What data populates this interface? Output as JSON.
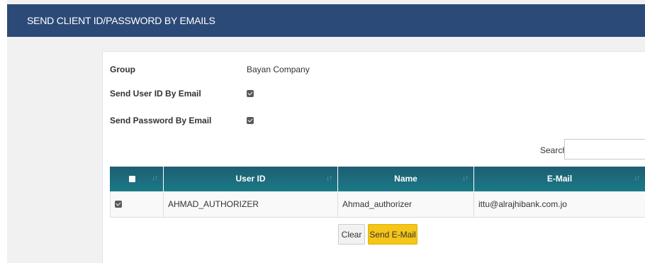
{
  "header": {
    "title": "SEND CLIENT ID/PASSWORD BY EMAILS"
  },
  "form": {
    "group_label": "Group",
    "group_value": "Bayan Company",
    "send_userid_label": "Send User ID By Email",
    "send_userid_checked": true,
    "send_password_label": "Send Password By Email",
    "send_password_checked": true
  },
  "search": {
    "label": "Search:",
    "value": "",
    "placeholder": ""
  },
  "table": {
    "columns": [
      "",
      "User ID",
      "Name",
      "E-Mail"
    ],
    "rows": [
      {
        "selected": true,
        "user_id": "AHMAD_AUTHORIZER",
        "name": "Ahmad_authorizer",
        "email": "ittu@alrajhibank.com.jo"
      }
    ]
  },
  "buttons": {
    "clear": "Clear",
    "send": "Send E-Mail"
  },
  "colors": {
    "header_bg": "#2c4a78",
    "table_header": "#1a6b7d",
    "send_button": "#f5c518"
  },
  "icons": {
    "sort": "sort-icon",
    "checkbox": "checkbox-icon"
  }
}
